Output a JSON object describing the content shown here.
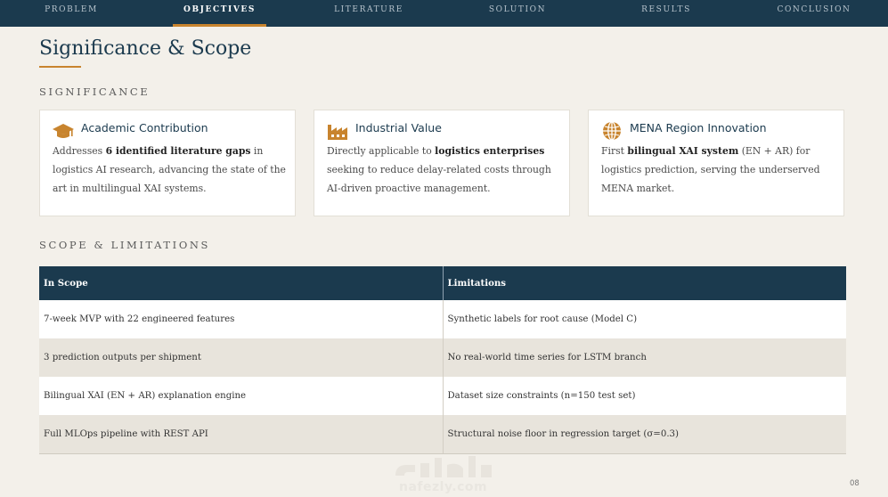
{
  "nav": {
    "items": [
      {
        "label": "PROBLEM"
      },
      {
        "label": "OBJECTIVES"
      },
      {
        "label": "LITERATURE"
      },
      {
        "label": "SOLUTION"
      },
      {
        "label": "RESULTS"
      },
      {
        "label": "CONCLUSION"
      }
    ],
    "active": "OBJECTIVES"
  },
  "page": {
    "title": "Significance & Scope",
    "number": "08"
  },
  "significance": {
    "heading": "SIGNIFICANCE",
    "cards": [
      {
        "icon": "graduation-cap-icon",
        "title": "Academic Contribution",
        "body_pre": "Addresses ",
        "body_bold": "6 identified literature gaps",
        "body_post": " in logistics AI research, advancing the state of the art in multilingual XAI systems."
      },
      {
        "icon": "factory-icon",
        "title": "Industrial Value",
        "body_pre": "Directly applicable to ",
        "body_bold": "logistics enterprises",
        "body_post": " seeking to reduce delay-related costs through AI-driven proactive management."
      },
      {
        "icon": "globe-icon",
        "title": "MENA Region Innovation",
        "body_pre": "First ",
        "body_bold": "bilingual XAI system",
        "body_post": " (EN + AR) for logistics prediction, serving the underserved MENA market."
      }
    ]
  },
  "scope": {
    "heading": "SCOPE & LIMITATIONS",
    "columns": [
      "In Scope",
      "Limitations"
    ],
    "rows": [
      [
        "7-week MVP with 22 engineered features",
        "Synthetic labels for root cause (Model C)"
      ],
      [
        "3 prediction outputs per shipment",
        "No real-world time series for LSTM branch"
      ],
      [
        "Bilingual XAI (EN + AR) explanation engine",
        "Dataset size constraints (n=150 test set)"
      ],
      [
        "Full MLOps pipeline with REST API",
        "Structural noise floor in regression target (σ=0.3)"
      ]
    ]
  },
  "watermark": {
    "text": "nafezly.com"
  },
  "colors": {
    "navy": "#1b3a4e",
    "accent": "#c8842e",
    "background": "#f3f0ea"
  }
}
